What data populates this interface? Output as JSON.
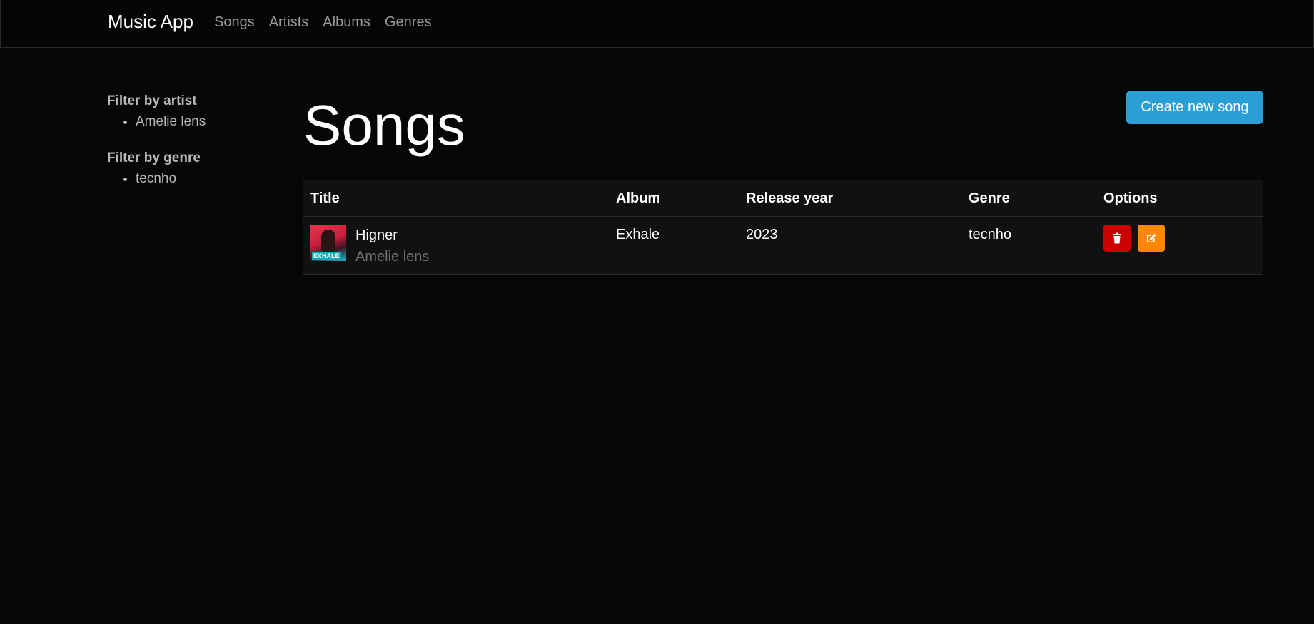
{
  "navbar": {
    "brand": "Music App",
    "links": [
      "Songs",
      "Artists",
      "Albums",
      "Genres"
    ]
  },
  "sidebar": {
    "artist_heading": "Filter by artist",
    "artists": [
      "Amelie lens"
    ],
    "genre_heading": "Filter by genre",
    "genres": [
      "tecnho"
    ]
  },
  "main": {
    "title": "Songs",
    "create_button": "Create new song"
  },
  "table": {
    "headers": [
      "Title",
      "Album",
      "Release year",
      "Genre",
      "Options"
    ],
    "rows": [
      {
        "title": "Higner",
        "artist": "Amelie lens",
        "album": "Exhale",
        "album_art_label": "EXHALE",
        "year": "2023",
        "genre": "tecnho"
      }
    ]
  },
  "colors": {
    "background": "#060606",
    "primary": "#2a9fd6",
    "danger": "#cc0000",
    "warning": "#ff8800"
  },
  "icons": {
    "delete": "trash-icon",
    "edit": "edit-icon"
  }
}
